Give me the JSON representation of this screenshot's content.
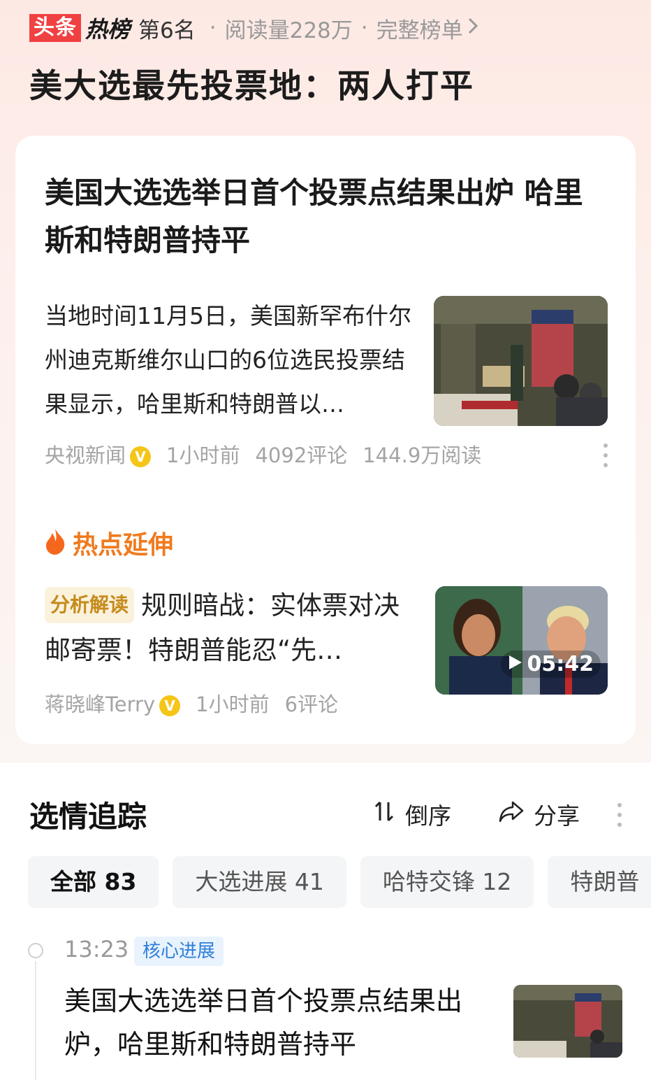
{
  "rank_header": {
    "logo_toutiao": "头条",
    "logo_hot": "热榜",
    "rank": "第6名",
    "reads": "阅读量228万",
    "full_list": "完整榜单"
  },
  "hot_title": "美大选最先投票地：两人打平",
  "article": {
    "title": "美国大选选举日首个投票点结果出炉 哈里斯和特朗普持平",
    "summary": "当地时间11月5日，美国新罕布什尔州迪克斯维尔山口的6位选民投票结果显示，哈里斯和特朗普以…",
    "source": "央视新闻",
    "verified_mark": "V",
    "time": "1小时前",
    "comments": "4092评论",
    "reads": "144.9万阅读"
  },
  "hot_extension": {
    "label": "热点延伸",
    "tag": "分析解读",
    "text": "规则暗战：实体票对决邮寄票！特朗普能忍“先…",
    "duration": "05:42",
    "author": "蒋晓峰Terry",
    "verified_mark": "V",
    "time": "1小时前",
    "comments": "6评论"
  },
  "tracking": {
    "title": "选情追踪",
    "sort_label": "倒序",
    "share_label": "分享",
    "chips": [
      "全部 83",
      "大选进展 41",
      "哈特交锋 12",
      "特朗普"
    ],
    "item": {
      "time": "13:23",
      "tag": "核心进展",
      "text": "美国大选选举日首个投票点结果出炉，哈里斯和特朗普持平"
    }
  },
  "colors": {
    "brand_red": "#f04142",
    "hot_orange": "#f07a1e",
    "tag_blue": "#2f7fd6",
    "verified_gold": "#f5c518"
  }
}
